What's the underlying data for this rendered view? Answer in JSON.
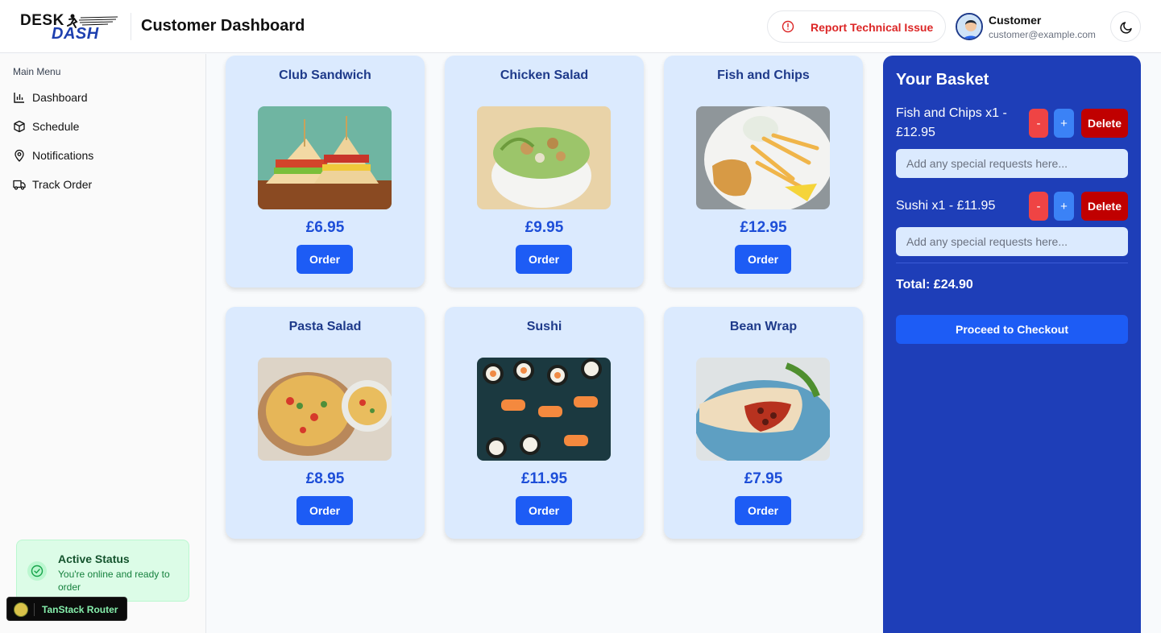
{
  "header": {
    "logo_top": "DESK",
    "logo_bottom": "DASH",
    "title": "Customer Dashboard",
    "report_label": "Report Technical Issue",
    "user_name": "Customer",
    "user_email": "customer@example.com"
  },
  "sidebar": {
    "heading": "Main Menu",
    "items": [
      {
        "label": "Dashboard",
        "icon": "bar-chart-icon"
      },
      {
        "label": "Schedule",
        "icon": "box-icon"
      },
      {
        "label": "Notifications",
        "icon": "map-pin-icon"
      },
      {
        "label": "Track Order",
        "icon": "truck-icon"
      }
    ],
    "status": {
      "title": "Active Status",
      "subtitle": "You're online and ready to order"
    }
  },
  "devtools": {
    "label": "TanStack Router"
  },
  "menu": [
    {
      "name": "Club Sandwich",
      "price": "£6.95",
      "button": "Order"
    },
    {
      "name": "Chicken Salad",
      "price": "£9.95",
      "button": "Order"
    },
    {
      "name": "Fish and Chips",
      "price": "£12.95",
      "button": "Order"
    },
    {
      "name": "Pasta Salad",
      "price": "£8.95",
      "button": "Order"
    },
    {
      "name": "Sushi",
      "price": "£11.95",
      "button": "Order"
    },
    {
      "name": "Bean Wrap",
      "price": "£7.95",
      "button": "Order"
    }
  ],
  "basket": {
    "title": "Your Basket",
    "items": [
      {
        "line1": "Fish and Chips x1 -",
        "line2": "£12.95"
      },
      {
        "line1": "Sushi x1 - £11.95",
        "line2": ""
      }
    ],
    "minus_label": "-",
    "plus_label": "+",
    "delete_label": "Delete",
    "request_placeholder": "Add any special requests here...",
    "total": "Total: £24.90",
    "checkout_label": "Proceed to Checkout"
  },
  "colors": {
    "primary": "#1d5cf5",
    "basket_bg": "#1e3eb8",
    "card_bg": "#dbeafe",
    "danger": "#dc2626"
  }
}
